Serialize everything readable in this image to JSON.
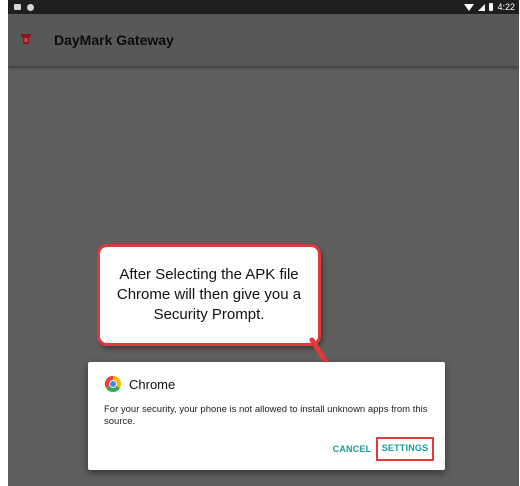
{
  "status_bar": {
    "time": "4:22",
    "icons": [
      "notification-icon",
      "sync-icon",
      "wifi-icon",
      "signal-icon",
      "battery-icon"
    ]
  },
  "app_bar": {
    "title": "DayMark Gateway",
    "icon": "daymark-logo-icon"
  },
  "callout": {
    "text": "After Selecting the APK file Chrome will then give you a Security Prompt."
  },
  "dialog": {
    "title": "Chrome",
    "icon": "chrome-icon",
    "message": "For your security, your phone is not allowed to install unknown apps from this source.",
    "cancel_label": "CANCEL",
    "settings_label": "SETTINGS"
  },
  "colors": {
    "overlay": "#5f5f5f",
    "app_bar": "#585858",
    "status_bar": "#1f1f1f",
    "accent": "#179a9a",
    "highlight": "#e0393b"
  }
}
